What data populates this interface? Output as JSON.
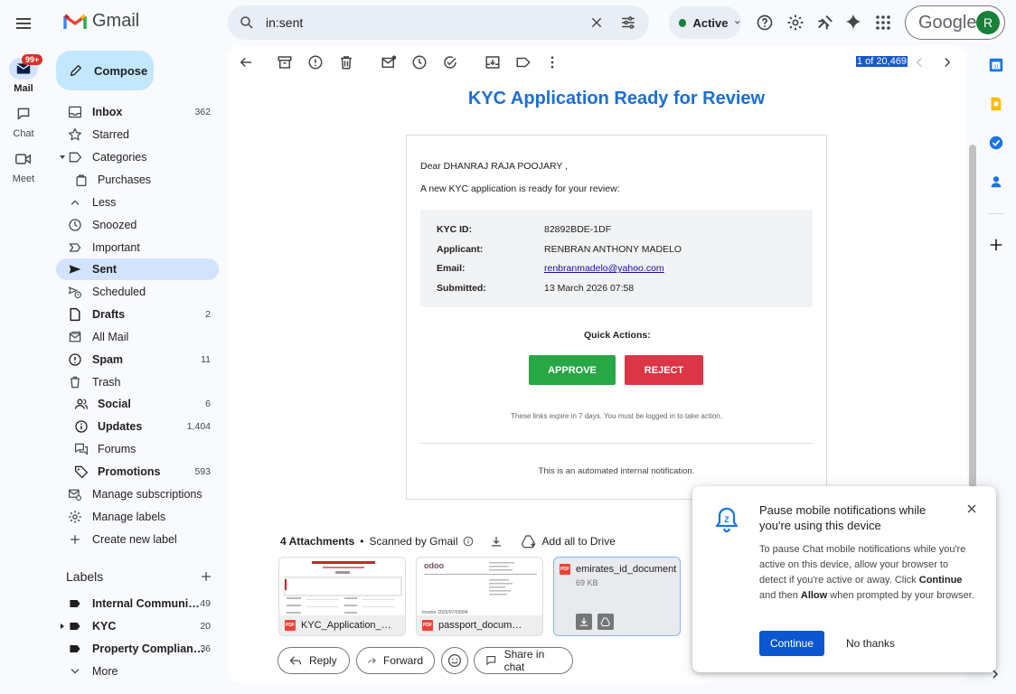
{
  "app": {
    "name": "Gmail"
  },
  "search": {
    "query": "in:sent"
  },
  "status": {
    "label": "Active"
  },
  "account": {
    "brand": "Google",
    "avatar_letter": "R"
  },
  "rail": {
    "badge": "99+",
    "items": [
      {
        "label": "Mail",
        "icon": "mail-icon"
      },
      {
        "label": "Chat",
        "icon": "chat-icon"
      },
      {
        "label": "Meet",
        "icon": "video-icon"
      }
    ]
  },
  "compose": {
    "label": "Compose"
  },
  "nav": [
    {
      "label": "Inbox",
      "count": "362",
      "icon": "inbox-icon",
      "bold": true
    },
    {
      "label": "Starred",
      "count": "",
      "icon": "star-icon"
    },
    {
      "label": "Categories",
      "count": "",
      "icon": "label-icon"
    },
    {
      "label": "Purchases",
      "count": "",
      "icon": "bag-icon",
      "sub": true
    },
    {
      "label": "Less",
      "count": "",
      "icon": "chevron-up-icon"
    },
    {
      "label": "Snoozed",
      "count": "",
      "icon": "clock-icon"
    },
    {
      "label": "Important",
      "count": "",
      "icon": "important-icon"
    },
    {
      "label": "Sent",
      "count": "",
      "icon": "send-icon",
      "bold": true,
      "selected": true
    },
    {
      "label": "Scheduled",
      "count": "",
      "icon": "scheduled-icon"
    },
    {
      "label": "Drafts",
      "count": "2",
      "icon": "draft-icon",
      "bold": true
    },
    {
      "label": "All Mail",
      "count": "",
      "icon": "all-mail-icon"
    },
    {
      "label": "Spam",
      "count": "11",
      "icon": "spam-icon",
      "bold": true
    },
    {
      "label": "Trash",
      "count": "",
      "icon": "trash-icon"
    },
    {
      "label": "Social",
      "count": "6",
      "icon": "people-icon",
      "bold": true,
      "sub": true
    },
    {
      "label": "Updates",
      "count": "1,404",
      "icon": "info-icon",
      "bold": true,
      "sub": true
    },
    {
      "label": "Forums",
      "count": "",
      "icon": "forum-icon",
      "sub": true
    },
    {
      "label": "Promotions",
      "count": "593",
      "icon": "tag-icon",
      "bold": true,
      "sub": true
    },
    {
      "label": "Manage subscriptions",
      "count": "",
      "icon": "subscriptions-icon"
    },
    {
      "label": "Manage labels",
      "count": "",
      "icon": "gear-icon"
    },
    {
      "label": "Create new label",
      "count": "",
      "icon": "plus-icon"
    }
  ],
  "labels": {
    "heading": "Labels",
    "items": [
      {
        "label": "Internal Communi…",
        "count": "49"
      },
      {
        "label": "KYC",
        "count": "20"
      },
      {
        "label": "Property Complian…",
        "count": "36"
      },
      {
        "label": "More",
        "count": ""
      }
    ]
  },
  "toolbar": {
    "page_count": "1 of 20,469"
  },
  "email": {
    "title": "KYC Application Ready for Review",
    "greeting": "Dear DHANRAJ RAJA POOJARY ,",
    "intro": "A new KYC application is ready for your review:",
    "fields": [
      {
        "key": "KYC ID:",
        "value": "82892BDE-1DF"
      },
      {
        "key": "Applicant:",
        "value": "RENBRAN ANTHONY MADELO"
      },
      {
        "key": "Email:",
        "value": "renbranmadelo@yahoo.com"
      },
      {
        "key": "Submitted:",
        "value": "13 March 2026 07:58"
      }
    ],
    "quick_actions": "Quick Actions:",
    "approve": "APPROVE",
    "reject": "REJECT",
    "expiry_note": "These links expire in 7 days. You must be logged in to take action.",
    "footer": "This is an automated internal notification."
  },
  "attachments": {
    "count_label": "4 Attachments",
    "scanned": "Scanned by Gmail",
    "add_all": "Add all to Drive",
    "files": [
      {
        "name": "KYC_Application_…"
      },
      {
        "name": "passport_docum…"
      },
      {
        "name": "emirates_id_document",
        "size": "69 KB"
      }
    ]
  },
  "actions": {
    "reply": "Reply",
    "forward": "Forward",
    "share": "Share in chat"
  },
  "notification": {
    "title": "Pause mobile notifications while you're using this device",
    "body_1": "To pause Chat mobile notifications while you're active on this device, allow your browser to detect if you're active or away. Click ",
    "body_bold_1": "Continue",
    "body_2": " and then ",
    "body_bold_2": "Allow",
    "body_3": " when prompted by your browser.",
    "continue": "Continue",
    "no_thanks": "No thanks"
  },
  "colors": {
    "accent": "#0b57d0",
    "approve": "#28a745",
    "reject": "#dc3545",
    "title_blue": "#1a6fd1",
    "selected_nav": "#d3e3fd",
    "compose": "#c2e7ff"
  }
}
